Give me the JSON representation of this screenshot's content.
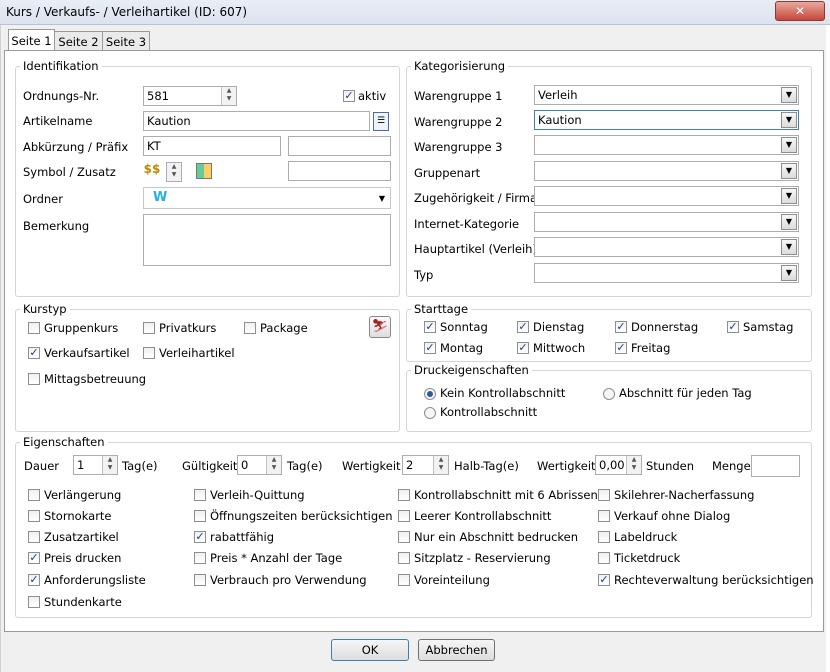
{
  "window": {
    "title": "Kurs / Verkaufs- / Verleihartikel (ID: 607)",
    "close_glyph": "✕"
  },
  "tabs": [
    "Seite 1",
    "Seite 2",
    "Seite 3"
  ],
  "ident": {
    "legend": "Identifikation",
    "ordnungsnr_label": "Ordnungs-Nr.",
    "ordnungsnr_value": "581",
    "aktiv_label": "aktiv",
    "artikelname_label": "Artikelname",
    "artikelname_value": "Kaution",
    "abk_label": "Abkürzung / Präfix",
    "abk_value": "KT",
    "symbol_label": "Symbol / Zusatz",
    "ordner_label": "Ordner",
    "ordner_value": "W",
    "bemerkung_label": "Bemerkung"
  },
  "kat": {
    "legend": "Kategorisierung",
    "rows": [
      {
        "label": "Warengruppe 1",
        "value": "Verleih"
      },
      {
        "label": "Warengruppe 2",
        "value": "Kaution"
      },
      {
        "label": "Warengruppe 3",
        "value": ""
      },
      {
        "label": "Gruppenart",
        "value": ""
      },
      {
        "label": "Zugehörigkeit / Firma",
        "value": ""
      },
      {
        "label": "Internet-Kategorie",
        "value": ""
      },
      {
        "label": "Hauptartikel (Verleih)",
        "value": ""
      },
      {
        "label": "Typ",
        "value": ""
      }
    ]
  },
  "kurstyp": {
    "legend": "Kurstyp",
    "items": [
      "Gruppenkurs",
      "Privatkurs",
      "Package",
      "Verkaufsartikel",
      "Verleihartikel",
      "Mittagsbetreuung"
    ]
  },
  "starttage": {
    "legend": "Starttage",
    "days": [
      "Sonntag",
      "Dienstag",
      "Donnerstag",
      "Samstag",
      "Montag",
      "Mittwoch",
      "Freitag"
    ]
  },
  "druck": {
    "legend": "Druckeigenschaften",
    "options": [
      "Kein Kontrollabschnitt",
      "Abschnitt für jeden Tag",
      "Kontrollabschnitt"
    ]
  },
  "eigen": {
    "legend": "Eigenschaften",
    "dauer_label": "Dauer",
    "dauer_value": "1",
    "dauer_unit": "Tag(e)",
    "gueltig_label": "Gültigkeit",
    "gueltig_value": "0",
    "gueltig_unit": "Tag(e)",
    "wert1_label": "Wertigkeit",
    "wert1_value": "2",
    "wert1_unit": "Halb-Tag(e)",
    "wert2_label": "Wertigkeit",
    "wert2_value": "0,00",
    "wert2_unit": "Stunden",
    "menge_label": "Menge",
    "checks": [
      "Verlängerung",
      "Stornokarte",
      "Zusatzartikel",
      "Preis drucken",
      "Anforderungsliste",
      "Stundenkarte",
      "Verleih-Quittung",
      "Öffnungszeiten berücksichtigen",
      "rabattfähig",
      "Preis * Anzahl der Tage",
      "Verbrauch pro Verwendung",
      "Kontrollabschnitt mit 6 Abrissen",
      "Leerer Kontrollabschnitt",
      "Nur ein Abschnitt bedrucken",
      "Sitzplatz - Reservierung",
      "Voreinteilung",
      "Skilehrer-Nacherfassung",
      "Verkauf ohne Dialog",
      "Labeldruck",
      "Ticketdruck",
      "Rechteverwaltung berücksichtigen"
    ]
  },
  "buttons": {
    "ok": "OK",
    "cancel": "Abbrechen"
  },
  "check_glyph": "✓"
}
